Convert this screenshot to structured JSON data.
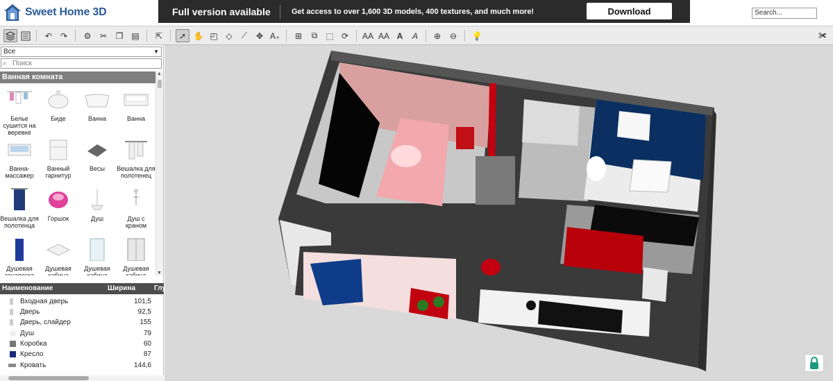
{
  "app": {
    "name": "Sweet Home 3D"
  },
  "promo": {
    "title": "Full version available",
    "text": "Get access to over 1,600 3D models, 400 textures, and much more!",
    "download_label": "Download"
  },
  "search": {
    "value": "Search..."
  },
  "toolbar_icons": [
    "catalog-view-icon",
    "furniture-list-icon",
    "undo-icon",
    "redo-icon",
    "copy-style-icon",
    "cut-icon",
    "copy-icon",
    "paste-icon",
    "add-furniture-icon",
    "select-mode-icon",
    "pan-mode-icon",
    "create-walls-icon",
    "create-rooms-icon",
    "create-polylines-icon",
    "create-dimensions-icon",
    "add-text-icon",
    "import-furniture-icon",
    "group-icon",
    "ungroup-icon",
    "rotate-icon",
    "increase-text-icon",
    "decrease-text-icon",
    "bold-text-icon",
    "italic-text-icon",
    "zoom-in-icon",
    "zoom-out-icon",
    "create-photo-icon",
    "preferences-icon"
  ],
  "catalog": {
    "category_select": "Все",
    "filter_placeholder": "Поиск",
    "category_header": "Ванная комната",
    "items": [
      {
        "label": "Белье сушится на веревке"
      },
      {
        "label": "Биде"
      },
      {
        "label": "Ванна"
      },
      {
        "label": "Ванна"
      },
      {
        "label": "Ванна-массажер"
      },
      {
        "label": "Ванный гарнитур"
      },
      {
        "label": "Весы"
      },
      {
        "label": "Вешалка для полотенец"
      },
      {
        "label": "Вешалка для полотенца"
      },
      {
        "label": "Горшок"
      },
      {
        "label": "Душ"
      },
      {
        "label": "Душ с краном"
      },
      {
        "label": "Душевая занавеска"
      },
      {
        "label": "Душевая кабина"
      },
      {
        "label": "Душевая кабина"
      },
      {
        "label": "Душевая кабина"
      }
    ]
  },
  "furniture_table": {
    "columns": [
      "Наименование",
      "Ширина",
      "Глу"
    ],
    "rows": [
      {
        "name": "Входная дверь",
        "width": "101,5"
      },
      {
        "name": "Дверь",
        "width": "92,5"
      },
      {
        "name": "Дверь, слайдер",
        "width": "155"
      },
      {
        "name": "Душ",
        "width": "79"
      },
      {
        "name": "Коробка",
        "width": "60"
      },
      {
        "name": "Кресло",
        "width": "87"
      },
      {
        "name": "Кровать",
        "width": "144,6"
      }
    ]
  },
  "colors": {
    "promo_bg": "#2b2b2b",
    "header_gray": "#7f7f7f",
    "table_header": "#4d4d4d",
    "view_bg": "#d9d9d9",
    "lock_green": "#1a9a7e"
  }
}
